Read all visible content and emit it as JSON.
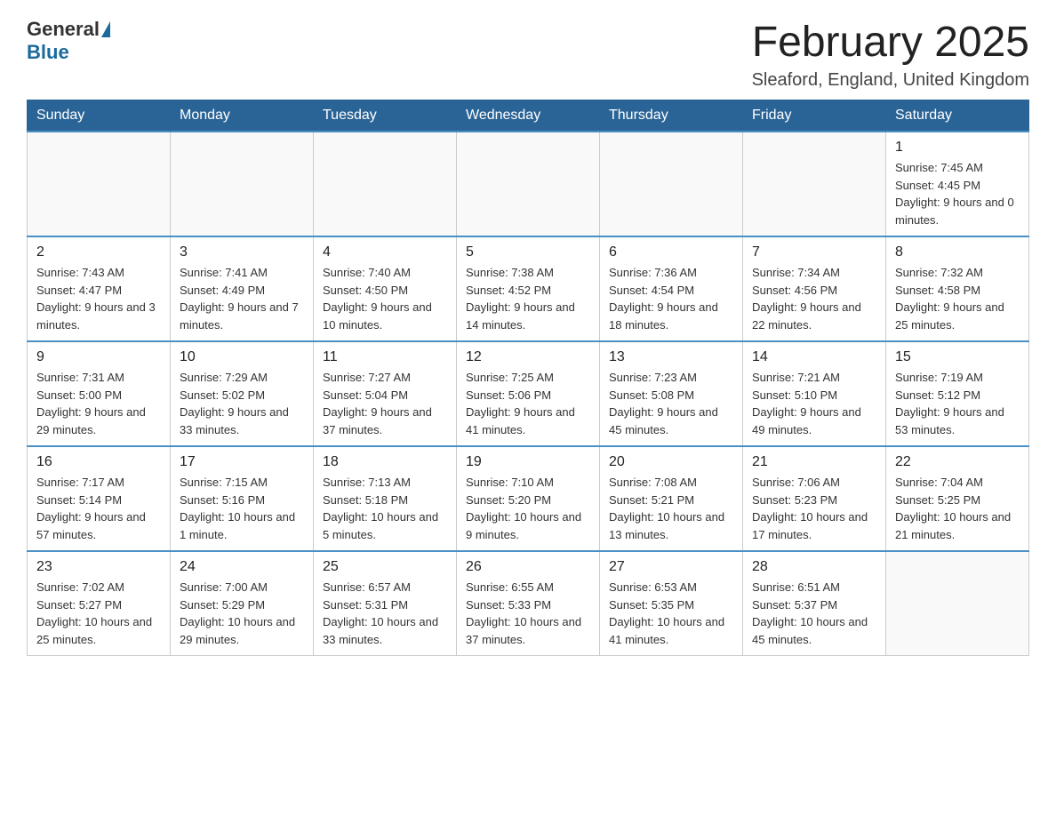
{
  "header": {
    "logo_general": "General",
    "logo_blue": "Blue",
    "month_title": "February 2025",
    "location": "Sleaford, England, United Kingdom"
  },
  "days_of_week": [
    "Sunday",
    "Monday",
    "Tuesday",
    "Wednesday",
    "Thursday",
    "Friday",
    "Saturday"
  ],
  "weeks": [
    {
      "days": [
        {
          "number": "",
          "info": ""
        },
        {
          "number": "",
          "info": ""
        },
        {
          "number": "",
          "info": ""
        },
        {
          "number": "",
          "info": ""
        },
        {
          "number": "",
          "info": ""
        },
        {
          "number": "",
          "info": ""
        },
        {
          "number": "1",
          "info": "Sunrise: 7:45 AM\nSunset: 4:45 PM\nDaylight: 9 hours and 0 minutes."
        }
      ]
    },
    {
      "days": [
        {
          "number": "2",
          "info": "Sunrise: 7:43 AM\nSunset: 4:47 PM\nDaylight: 9 hours and 3 minutes."
        },
        {
          "number": "3",
          "info": "Sunrise: 7:41 AM\nSunset: 4:49 PM\nDaylight: 9 hours and 7 minutes."
        },
        {
          "number": "4",
          "info": "Sunrise: 7:40 AM\nSunset: 4:50 PM\nDaylight: 9 hours and 10 minutes."
        },
        {
          "number": "5",
          "info": "Sunrise: 7:38 AM\nSunset: 4:52 PM\nDaylight: 9 hours and 14 minutes."
        },
        {
          "number": "6",
          "info": "Sunrise: 7:36 AM\nSunset: 4:54 PM\nDaylight: 9 hours and 18 minutes."
        },
        {
          "number": "7",
          "info": "Sunrise: 7:34 AM\nSunset: 4:56 PM\nDaylight: 9 hours and 22 minutes."
        },
        {
          "number": "8",
          "info": "Sunrise: 7:32 AM\nSunset: 4:58 PM\nDaylight: 9 hours and 25 minutes."
        }
      ]
    },
    {
      "days": [
        {
          "number": "9",
          "info": "Sunrise: 7:31 AM\nSunset: 5:00 PM\nDaylight: 9 hours and 29 minutes."
        },
        {
          "number": "10",
          "info": "Sunrise: 7:29 AM\nSunset: 5:02 PM\nDaylight: 9 hours and 33 minutes."
        },
        {
          "number": "11",
          "info": "Sunrise: 7:27 AM\nSunset: 5:04 PM\nDaylight: 9 hours and 37 minutes."
        },
        {
          "number": "12",
          "info": "Sunrise: 7:25 AM\nSunset: 5:06 PM\nDaylight: 9 hours and 41 minutes."
        },
        {
          "number": "13",
          "info": "Sunrise: 7:23 AM\nSunset: 5:08 PM\nDaylight: 9 hours and 45 minutes."
        },
        {
          "number": "14",
          "info": "Sunrise: 7:21 AM\nSunset: 5:10 PM\nDaylight: 9 hours and 49 minutes."
        },
        {
          "number": "15",
          "info": "Sunrise: 7:19 AM\nSunset: 5:12 PM\nDaylight: 9 hours and 53 minutes."
        }
      ]
    },
    {
      "days": [
        {
          "number": "16",
          "info": "Sunrise: 7:17 AM\nSunset: 5:14 PM\nDaylight: 9 hours and 57 minutes."
        },
        {
          "number": "17",
          "info": "Sunrise: 7:15 AM\nSunset: 5:16 PM\nDaylight: 10 hours and 1 minute."
        },
        {
          "number": "18",
          "info": "Sunrise: 7:13 AM\nSunset: 5:18 PM\nDaylight: 10 hours and 5 minutes."
        },
        {
          "number": "19",
          "info": "Sunrise: 7:10 AM\nSunset: 5:20 PM\nDaylight: 10 hours and 9 minutes."
        },
        {
          "number": "20",
          "info": "Sunrise: 7:08 AM\nSunset: 5:21 PM\nDaylight: 10 hours and 13 minutes."
        },
        {
          "number": "21",
          "info": "Sunrise: 7:06 AM\nSunset: 5:23 PM\nDaylight: 10 hours and 17 minutes."
        },
        {
          "number": "22",
          "info": "Sunrise: 7:04 AM\nSunset: 5:25 PM\nDaylight: 10 hours and 21 minutes."
        }
      ]
    },
    {
      "days": [
        {
          "number": "23",
          "info": "Sunrise: 7:02 AM\nSunset: 5:27 PM\nDaylight: 10 hours and 25 minutes."
        },
        {
          "number": "24",
          "info": "Sunrise: 7:00 AM\nSunset: 5:29 PM\nDaylight: 10 hours and 29 minutes."
        },
        {
          "number": "25",
          "info": "Sunrise: 6:57 AM\nSunset: 5:31 PM\nDaylight: 10 hours and 33 minutes."
        },
        {
          "number": "26",
          "info": "Sunrise: 6:55 AM\nSunset: 5:33 PM\nDaylight: 10 hours and 37 minutes."
        },
        {
          "number": "27",
          "info": "Sunrise: 6:53 AM\nSunset: 5:35 PM\nDaylight: 10 hours and 41 minutes."
        },
        {
          "number": "28",
          "info": "Sunrise: 6:51 AM\nSunset: 5:37 PM\nDaylight: 10 hours and 45 minutes."
        },
        {
          "number": "",
          "info": ""
        }
      ]
    }
  ]
}
